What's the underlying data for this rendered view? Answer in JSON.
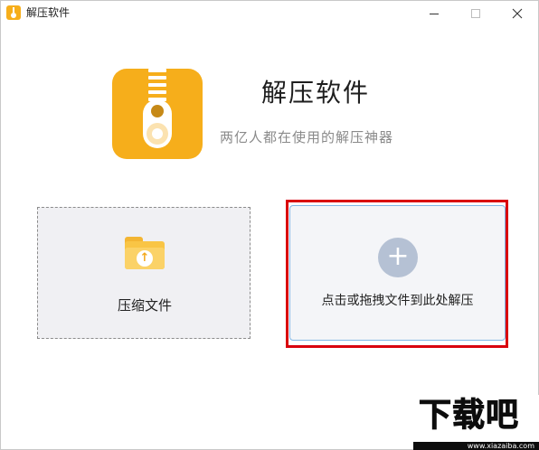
{
  "window": {
    "title": "解压软件",
    "controls": [
      "minimize",
      "maximize",
      "close"
    ]
  },
  "header": {
    "app_name": "解压软件",
    "slogan": "两亿人都在使用的解压神器"
  },
  "compress": {
    "label": "压缩文件",
    "icon": "folder-upload-icon"
  },
  "extract": {
    "label": "点击或拖拽文件到此处解压",
    "icon": "plus-icon"
  },
  "watermark": {
    "brand": "下载吧",
    "url": "www.xiazaiba.com"
  },
  "colors": {
    "accent": "#f6ae1b",
    "highlight": "#d9000d",
    "drop_border": "#7fb6e6",
    "plus_circle": "#b5c1d4"
  }
}
